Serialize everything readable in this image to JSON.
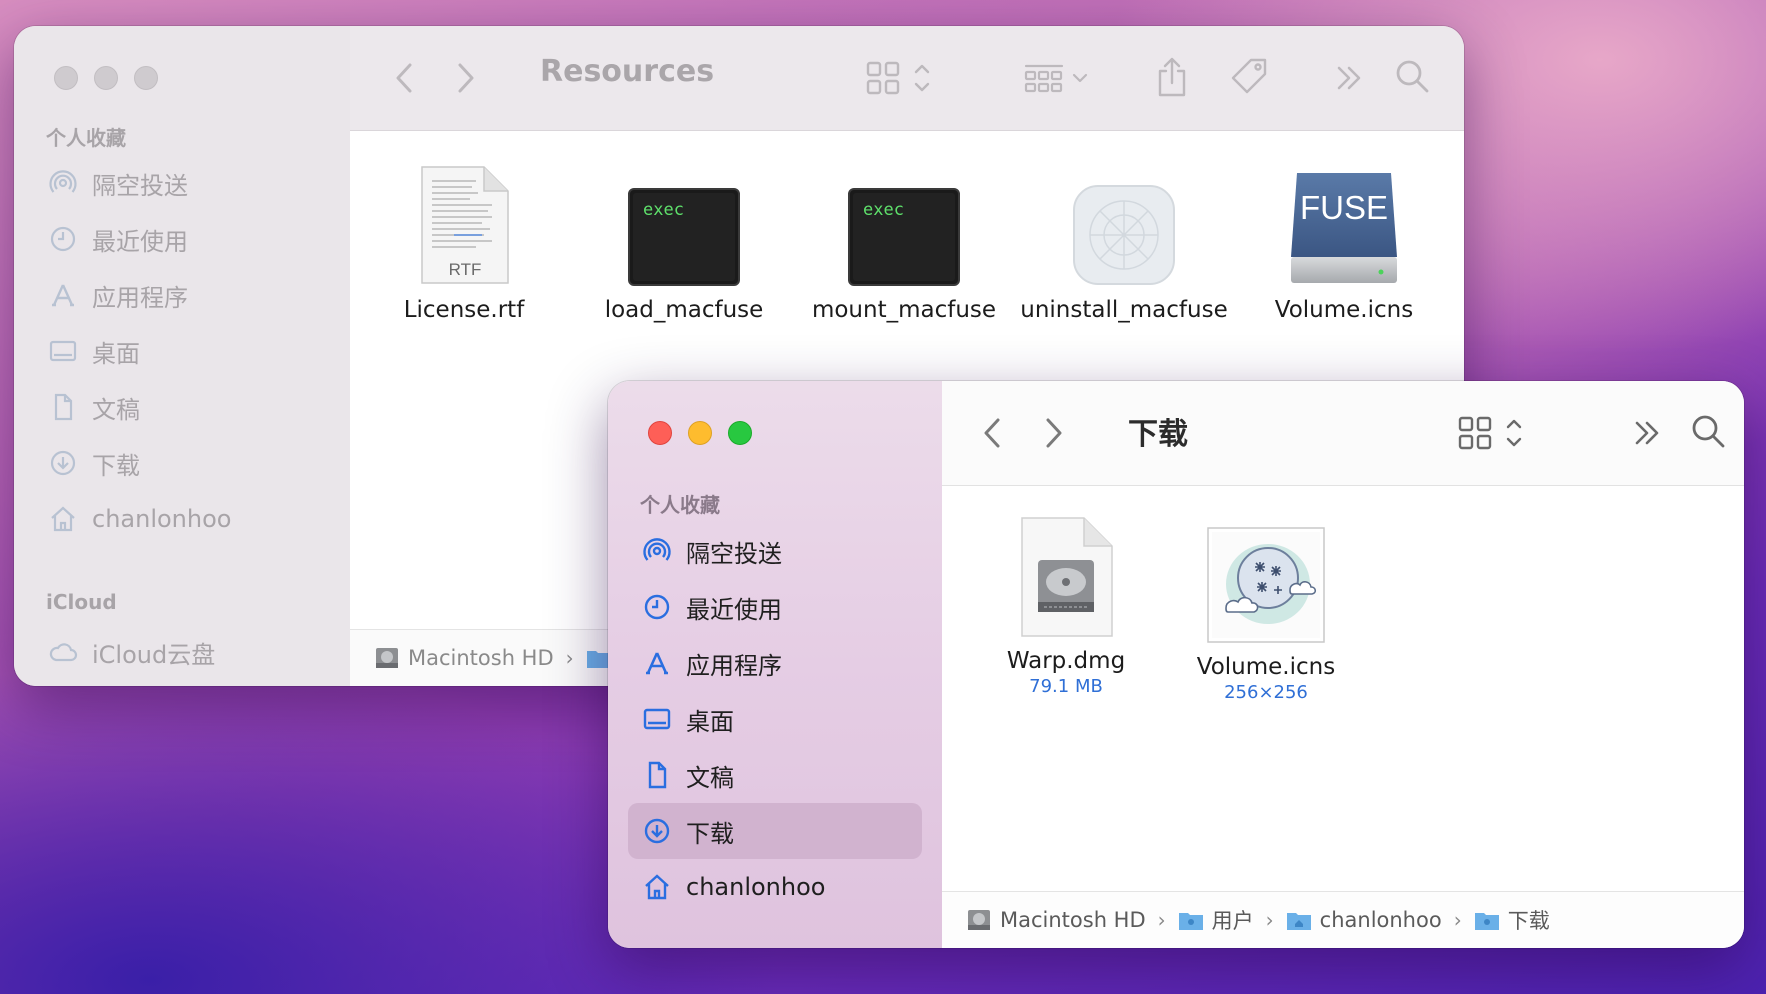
{
  "back_window": {
    "title": "Resources",
    "sidebar": {
      "favorites_title": "个人收藏",
      "items": [
        {
          "label": "隔空投送",
          "icon": "airdrop-icon"
        },
        {
          "label": "最近使用",
          "icon": "clock-icon"
        },
        {
          "label": "应用程序",
          "icon": "applications-icon"
        },
        {
          "label": "桌面",
          "icon": "desktop-icon"
        },
        {
          "label": "文稿",
          "icon": "document-icon"
        },
        {
          "label": "下载",
          "icon": "download-icon"
        },
        {
          "label": "chanlonhoo",
          "icon": "home-icon"
        }
      ],
      "icloud_title": "iCloud",
      "icloud_items": [
        {
          "label": "iCloud云盘",
          "icon": "cloud-icon"
        }
      ]
    },
    "files": [
      {
        "name": "License.rtf",
        "icon": "rtf-document-icon",
        "badge": "RTF"
      },
      {
        "name": "load_macfuse",
        "icon": "exec-icon",
        "badge": "exec"
      },
      {
        "name": "mount_macfuse",
        "icon": "exec-icon",
        "badge": "exec"
      },
      {
        "name": "uninstall_macfuse",
        "icon": "generic-app-icon"
      },
      {
        "name": "Volume.icns",
        "icon": "fuse-drive-icon",
        "badge": "FUSE"
      }
    ],
    "pathbar": [
      {
        "label": "Macintosh HD",
        "icon": "harddisk-icon"
      }
    ]
  },
  "front_window": {
    "title": "下载",
    "sidebar": {
      "favorites_title": "个人收藏",
      "items": [
        {
          "label": "隔空投送",
          "icon": "airdrop-icon"
        },
        {
          "label": "最近使用",
          "icon": "clock-icon"
        },
        {
          "label": "应用程序",
          "icon": "applications-icon"
        },
        {
          "label": "桌面",
          "icon": "desktop-icon"
        },
        {
          "label": "文稿",
          "icon": "document-icon"
        },
        {
          "label": "下载",
          "icon": "download-icon",
          "selected": true
        },
        {
          "label": "chanlonhoo",
          "icon": "home-icon"
        }
      ]
    },
    "files": [
      {
        "name": "Warp.dmg",
        "meta": "79.1 MB",
        "icon": "disk-image-icon"
      },
      {
        "name": "Volume.icns",
        "meta": "256×256",
        "icon": "snowflake-thumbnail-icon"
      }
    ],
    "pathbar": [
      {
        "label": "Macintosh HD",
        "icon": "harddisk-icon"
      },
      {
        "label": "用户",
        "icon": "folder-icon"
      },
      {
        "label": "chanlonhoo",
        "icon": "home-folder-icon"
      },
      {
        "label": "下载",
        "icon": "folder-icon"
      }
    ]
  },
  "colors": {
    "accent": "#2a6ee0",
    "selection": "#d1b3cf",
    "close": "#fe5f57",
    "minimize": "#febc2e",
    "zoom": "#28c840"
  }
}
